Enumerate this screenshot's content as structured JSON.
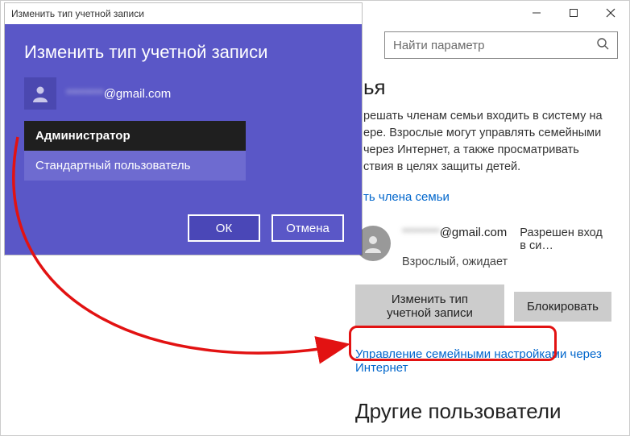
{
  "settings": {
    "search_placeholder": "Найти параметр",
    "section_family_header": "ья",
    "family_text_visible": "решать членам семьи входить в систему на ере. Взрослые могут управлять семейными через Интернет, а также просматривать ствия в целях защиты детей.",
    "add_member_link": "ть члена семьи",
    "user": {
      "email_masked": "********",
      "email_domain": "@gmail.com",
      "login_status": "Разрешен вход в си…",
      "sub_status": "Взрослый, ожидает"
    },
    "buttons": {
      "change_type": "Изменить тип учетной записи",
      "block": "Блокировать"
    },
    "manage_link": "Управление семейными настройками через Интернет",
    "other_users_header": "Другие пользователи"
  },
  "modal": {
    "title": "Изменить тип учетной записи",
    "heading": "Изменить тип учетной записи",
    "user_email_masked": "********",
    "user_email_domain": "@gmail.com",
    "role_admin": "Администратор",
    "role_standard": "Стандартный пользователь",
    "ok": "ОК",
    "cancel": "Отмена"
  },
  "icons": {
    "minimize": "minimize",
    "maximize": "maximize",
    "close": "close",
    "search": "search",
    "user": "user"
  }
}
